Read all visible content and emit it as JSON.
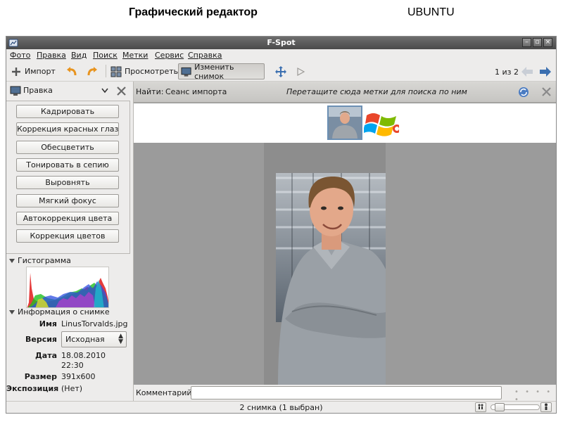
{
  "slide": {
    "title": "Графический редактор",
    "subtitle": "UBUNTU"
  },
  "window": {
    "title": "F-Spot"
  },
  "menu": [
    "Фото",
    "Правка",
    "Вид",
    "Поиск",
    "Метки",
    "Сервис",
    "Справка"
  ],
  "toolbar": {
    "import_label": "Импорт",
    "view_label": "Просмотреть",
    "edit_label": "Изменить снимок",
    "counter": "1 из 2"
  },
  "sidebar": {
    "mode_label": "Правка",
    "edit_buttons": [
      "Кадрировать",
      "Коррекция красных глаз",
      "Обесцветить",
      "Тонировать в сепию",
      "Выровнять",
      "Мягкий фокус",
      "Автокоррекция цвета",
      "Коррекция цветов"
    ],
    "histogram_title": "Гистограмма",
    "info_title": "Информация о снимке",
    "info": {
      "name_label": "Имя",
      "name_value": "LinusTorvalds.jpg",
      "version_label": "Версия",
      "version_value": "Исходная",
      "date_label": "Дата",
      "date_value": "18.08.2010",
      "time_value": "22:30",
      "size_label": "Размер",
      "size_value": "391x600",
      "exposure_label": "Экспозиция",
      "exposure_value": "(Нет)"
    }
  },
  "findbar": {
    "find_label": "Найти:",
    "session_label": "Сеанс импорта",
    "hint": "Перетащите сюда метки для поиска по ним"
  },
  "comment": {
    "label": "Комментарий:",
    "value": ""
  },
  "status": {
    "text": "2 снимка (1 выбран)",
    "zoom": 0.1
  },
  "colors": {
    "accent": "#3b6fb0",
    "titlebar": "#5a5a5a",
    "background": "#edeceb"
  }
}
